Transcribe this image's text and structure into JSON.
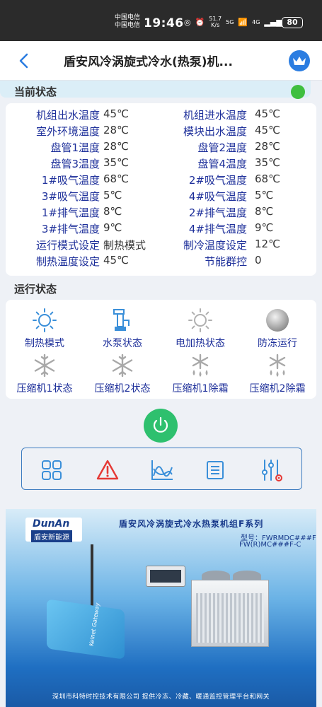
{
  "status_bar": {
    "carrier1": "中国电信",
    "carrier2": "中国电信",
    "time": "19:46",
    "speed_value": "51.7",
    "speed_unit": "K/s",
    "net1": "5G",
    "net2": "4G",
    "battery": "80"
  },
  "header": {
    "title": "盾安风冷涡旋式冷水(热泵)机..."
  },
  "current_status": {
    "title": "当前状态",
    "online_color": "#3fbf3f",
    "rows": [
      {
        "l1": "机组出水温度",
        "v1": "45℃",
        "l2": "机组进水温度",
        "v2": "45℃"
      },
      {
        "l1": "室外环境温度",
        "v1": "28℃",
        "l2": "模块出水温度",
        "v2": "45℃"
      },
      {
        "l1": "盘管1温度",
        "v1": "28℃",
        "l2": "盘管2温度",
        "v2": "28℃"
      },
      {
        "l1": "盘管3温度",
        "v1": "35℃",
        "l2": "盘管4温度",
        "v2": "35℃"
      },
      {
        "l1": "1#吸气温度",
        "v1": "68℃",
        "l2": "2#吸气温度",
        "v2": "68℃"
      },
      {
        "l1": "3#吸气温度",
        "v1": "5℃",
        "l2": "4#吸气温度",
        "v2": "5℃"
      },
      {
        "l1": "1#排气温度",
        "v1": "8℃",
        "l2": "2#排气温度",
        "v2": "8℃"
      },
      {
        "l1": "3#排气温度",
        "v1": "9℃",
        "l2": "4#排气温度",
        "v2": "9℃"
      },
      {
        "l1": "运行模式设定",
        "v1": "制热模式",
        "l2": "制冷温度设定",
        "v2": "12℃"
      },
      {
        "l1": "制热温度设定",
        "v1": "45℃",
        "l2": "节能群控",
        "v2": "0"
      }
    ]
  },
  "run_status": {
    "title": "运行状态",
    "items": [
      {
        "label": "制热模式",
        "icon": "sun-icon"
      },
      {
        "label": "水泵状态",
        "icon": "pump-icon"
      },
      {
        "label": "电加热状态",
        "icon": "sun-grey-icon"
      },
      {
        "label": "防冻运行",
        "icon": "ball-icon"
      },
      {
        "label": "压缩机1状态",
        "icon": "snowflake-icon"
      },
      {
        "label": "压缩机2状态",
        "icon": "snowflake-icon"
      },
      {
        "label": "压缩机1除霜",
        "icon": "defrost-icon"
      },
      {
        "label": "压缩机2除霜",
        "icon": "defrost-icon"
      }
    ]
  },
  "controls": {
    "power_color": "#2ec06e",
    "tools": [
      "grid-icon",
      "alarm-icon",
      "chart-icon",
      "list-icon",
      "settings-icon"
    ]
  },
  "banner": {
    "brand_en": "DunAn",
    "brand_cn": "盾安新能源",
    "title": "盾安风冷涡旋式冷水热泵机组F系列",
    "model1": "型号：FWRMDC###F",
    "model2": "FW(R)MC###F-C",
    "gateway_brand": "Kelnet",
    "gateway_label": "Gateway",
    "footer": "深圳市科特时控技术有限公司   提供冷冻、冷藏、暖通监控管理平台和网关"
  }
}
